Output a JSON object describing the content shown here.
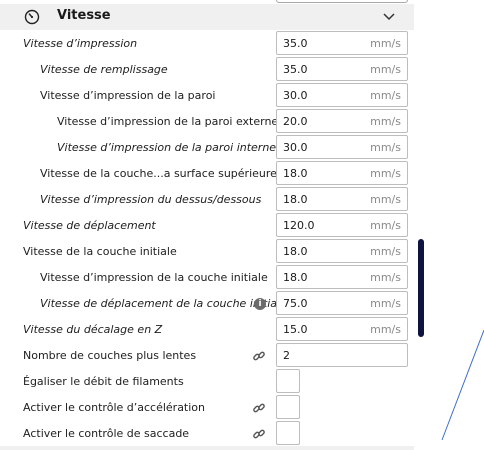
{
  "section": {
    "title": "Vitesse"
  },
  "rows": [
    {
      "label": "Vitesse d’impression",
      "value": "35.0",
      "unit": "mm/s"
    },
    {
      "label": "Vitesse de remplissage",
      "value": "35.0",
      "unit": "mm/s"
    },
    {
      "label": "Vitesse d’impression de la paroi",
      "value": "30.0",
      "unit": "mm/s"
    },
    {
      "label": "Vitesse d’impression de la paroi externe",
      "value": "20.0",
      "unit": "mm/s"
    },
    {
      "label": "Vitesse d’impression de la paroi interne",
      "value": "30.0",
      "unit": "mm/s"
    },
    {
      "label": "Vitesse de la couche...a surface supérieure",
      "value": "18.0",
      "unit": "mm/s"
    },
    {
      "label": "Vitesse d’impression du dessus/dessous",
      "value": "18.0",
      "unit": "mm/s"
    },
    {
      "label": "Vitesse de déplacement",
      "value": "120.0",
      "unit": "mm/s"
    },
    {
      "label": "Vitesse de la couche initiale",
      "value": "18.0",
      "unit": "mm/s"
    },
    {
      "label": "Vitesse d’impression de la couche initiale",
      "value": "18.0",
      "unit": "mm/s"
    },
    {
      "label": "Vitesse de déplacement de la couche initiale",
      "value": "75.0",
      "unit": "mm/s"
    },
    {
      "label": "Vitesse du décalage en Z",
      "value": "15.0",
      "unit": "mm/s"
    },
    {
      "label": "Nombre de couches plus lentes",
      "value": "2"
    },
    {
      "label": "Égaliser le débit de filaments"
    },
    {
      "label": "Activer le contrôle d’accélération"
    },
    {
      "label": "Activer le contrôle de saccade"
    }
  ],
  "icons": {
    "header": "gauge-icon",
    "collapse": "chevron-up-icon",
    "link": "link-icon",
    "info": "info-icon"
  },
  "colors": {
    "header_bg": "#f0f0f0",
    "scrollbar": "#0d1440"
  }
}
